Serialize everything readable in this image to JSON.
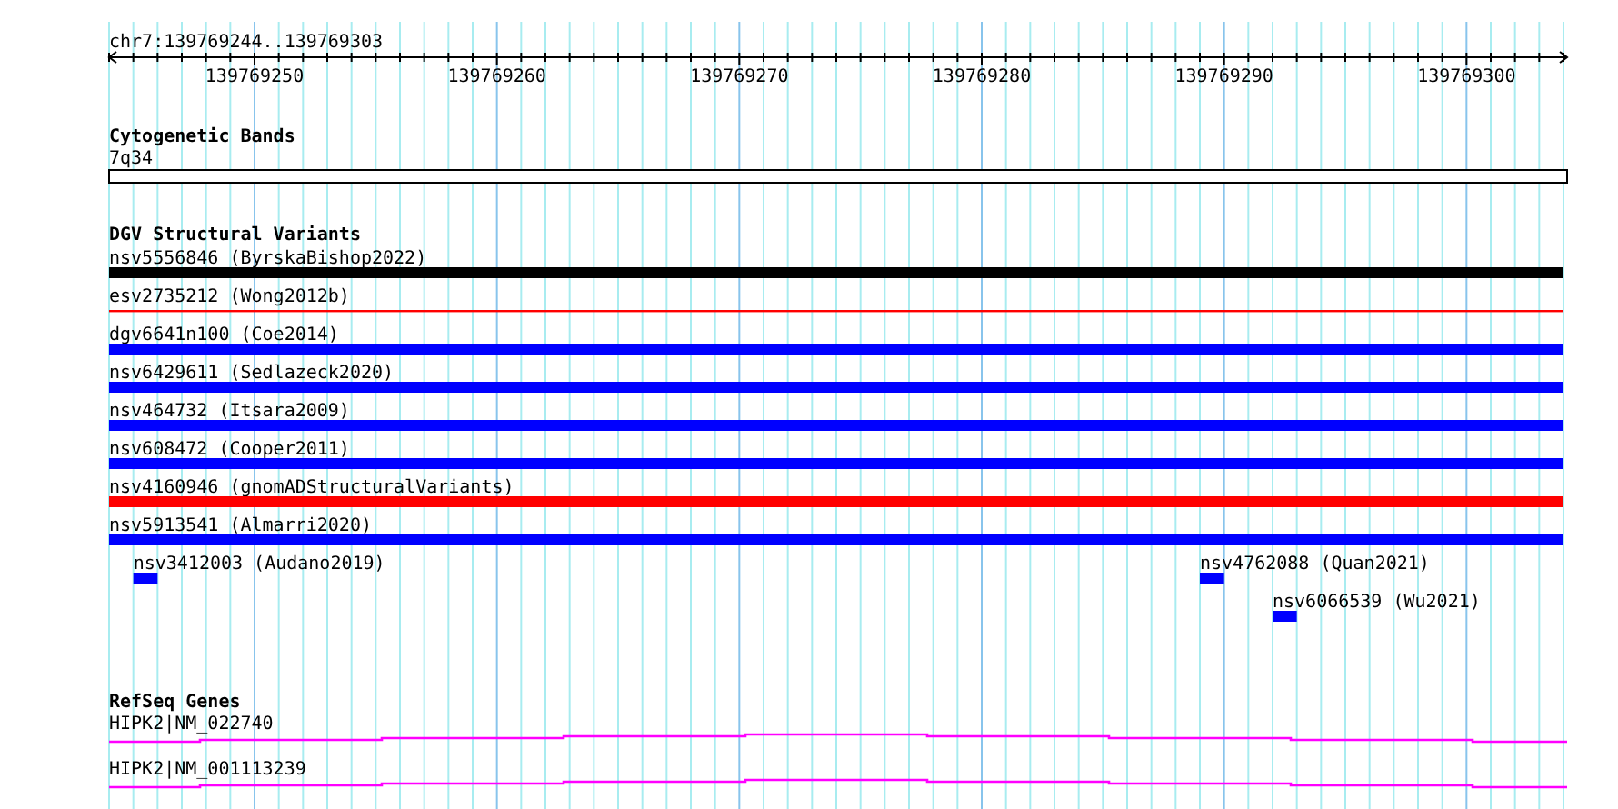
{
  "ruler": {
    "title": "chr7:139769244..139769303",
    "ticks": [
      "139769250",
      "139769260",
      "139769270",
      "139769280",
      "139769290",
      "139769300"
    ]
  },
  "tracks": [
    {
      "title": "Cytogenetic Bands",
      "features": [
        {
          "label": "7q34",
          "kind": "band"
        }
      ]
    },
    {
      "title": "DGV Structural Variants",
      "features": [
        {
          "label": "nsv5556846 (ByrskaBishop2022)",
          "kind": "bar",
          "color": "#000000"
        },
        {
          "label": "esv2735212 (Wong2012b)",
          "kind": "line",
          "color": "#ff0000"
        },
        {
          "label": "dgv6641n100 (Coe2014)",
          "kind": "bar",
          "color": "#0000ff"
        },
        {
          "label": "nsv6429611 (Sedlazeck2020)",
          "kind": "bar",
          "color": "#0000ff"
        },
        {
          "label": "nsv464732 (Itsara2009)",
          "kind": "bar",
          "color": "#0000ff"
        },
        {
          "label": "nsv608472 (Cooper2011)",
          "kind": "bar",
          "color": "#0000ff"
        },
        {
          "label": "nsv4160946 (gnomADStructuralVariants)",
          "kind": "bar",
          "color": "#ff0000"
        },
        {
          "label": "nsv5913541 (Almarri2020)",
          "kind": "bar",
          "color": "#0000ff"
        },
        {
          "label": "nsv3412003 (Audano2019)",
          "kind": "bar",
          "color": "#0000ff"
        },
        {
          "label": "nsv4762088 (Quan2021)",
          "kind": "bar",
          "color": "#0000ff"
        },
        {
          "label": "nsv6066539 (Wu2021)",
          "kind": "bar",
          "color": "#0000ff"
        }
      ]
    },
    {
      "title": "RefSeq Genes",
      "features": [
        {
          "label": "HIPK2|NM_022740",
          "kind": "gene"
        },
        {
          "label": "HIPK2|NM_001113239",
          "kind": "gene"
        }
      ]
    }
  ]
}
